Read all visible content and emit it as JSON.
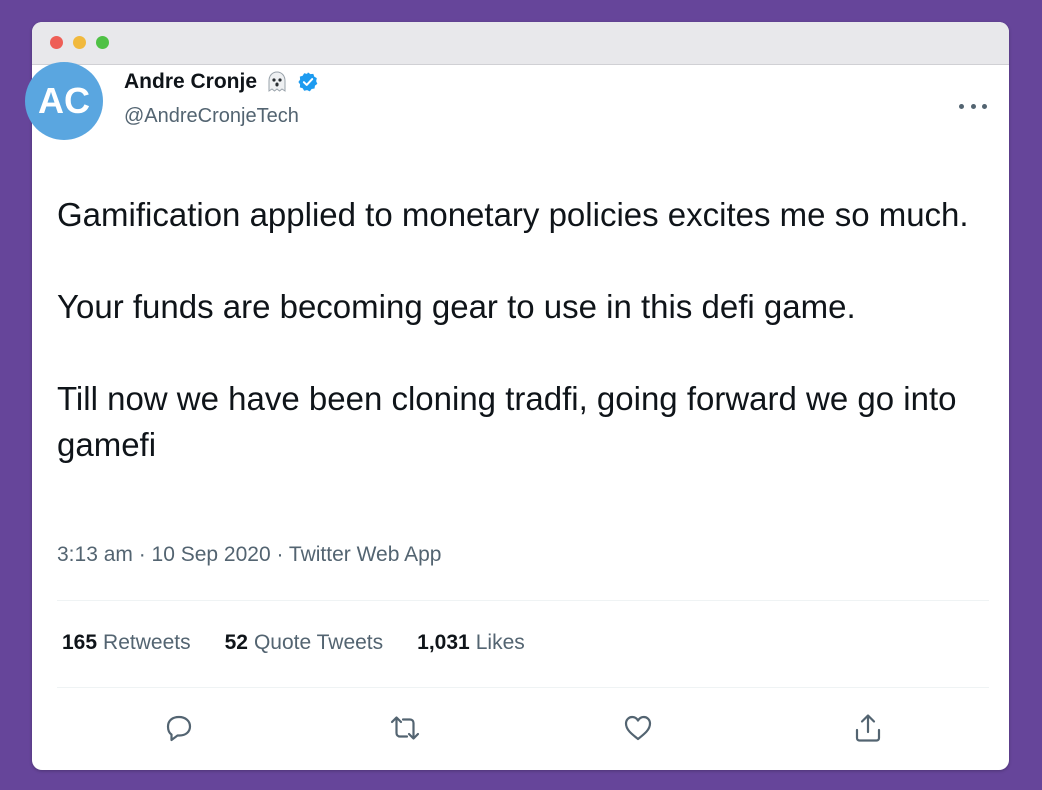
{
  "window": {
    "traffic_lights": [
      "close",
      "minimize",
      "zoom"
    ]
  },
  "tweet": {
    "avatar_initials": "AC",
    "display_name": "Andre Cronje",
    "handle": "@AndreCronjeTech",
    "emoji": "ghost-icon",
    "verified": true,
    "paragraphs": [
      "Gamification applied to monetary policies excites me so much.",
      "Your funds are becoming gear to use in this defi game.",
      "Till now we have been cloning tradfi, going forward we go into gamefi"
    ],
    "meta": "3:13 am · 10 Sep 2020 · Twitter Web App"
  },
  "stats": {
    "retweets_count": "165",
    "retweets_label": "Retweets",
    "quotes_count": "52",
    "quotes_label": "Quote Tweets",
    "likes_count": "1,031",
    "likes_label": "Likes"
  },
  "actions": [
    "reply-icon",
    "retweet-icon",
    "like-icon",
    "share-icon"
  ],
  "colors": {
    "background": "#66459a",
    "avatar": "#5aa6e0",
    "verified": "#1d9bf0",
    "secondary_text": "#536471"
  }
}
